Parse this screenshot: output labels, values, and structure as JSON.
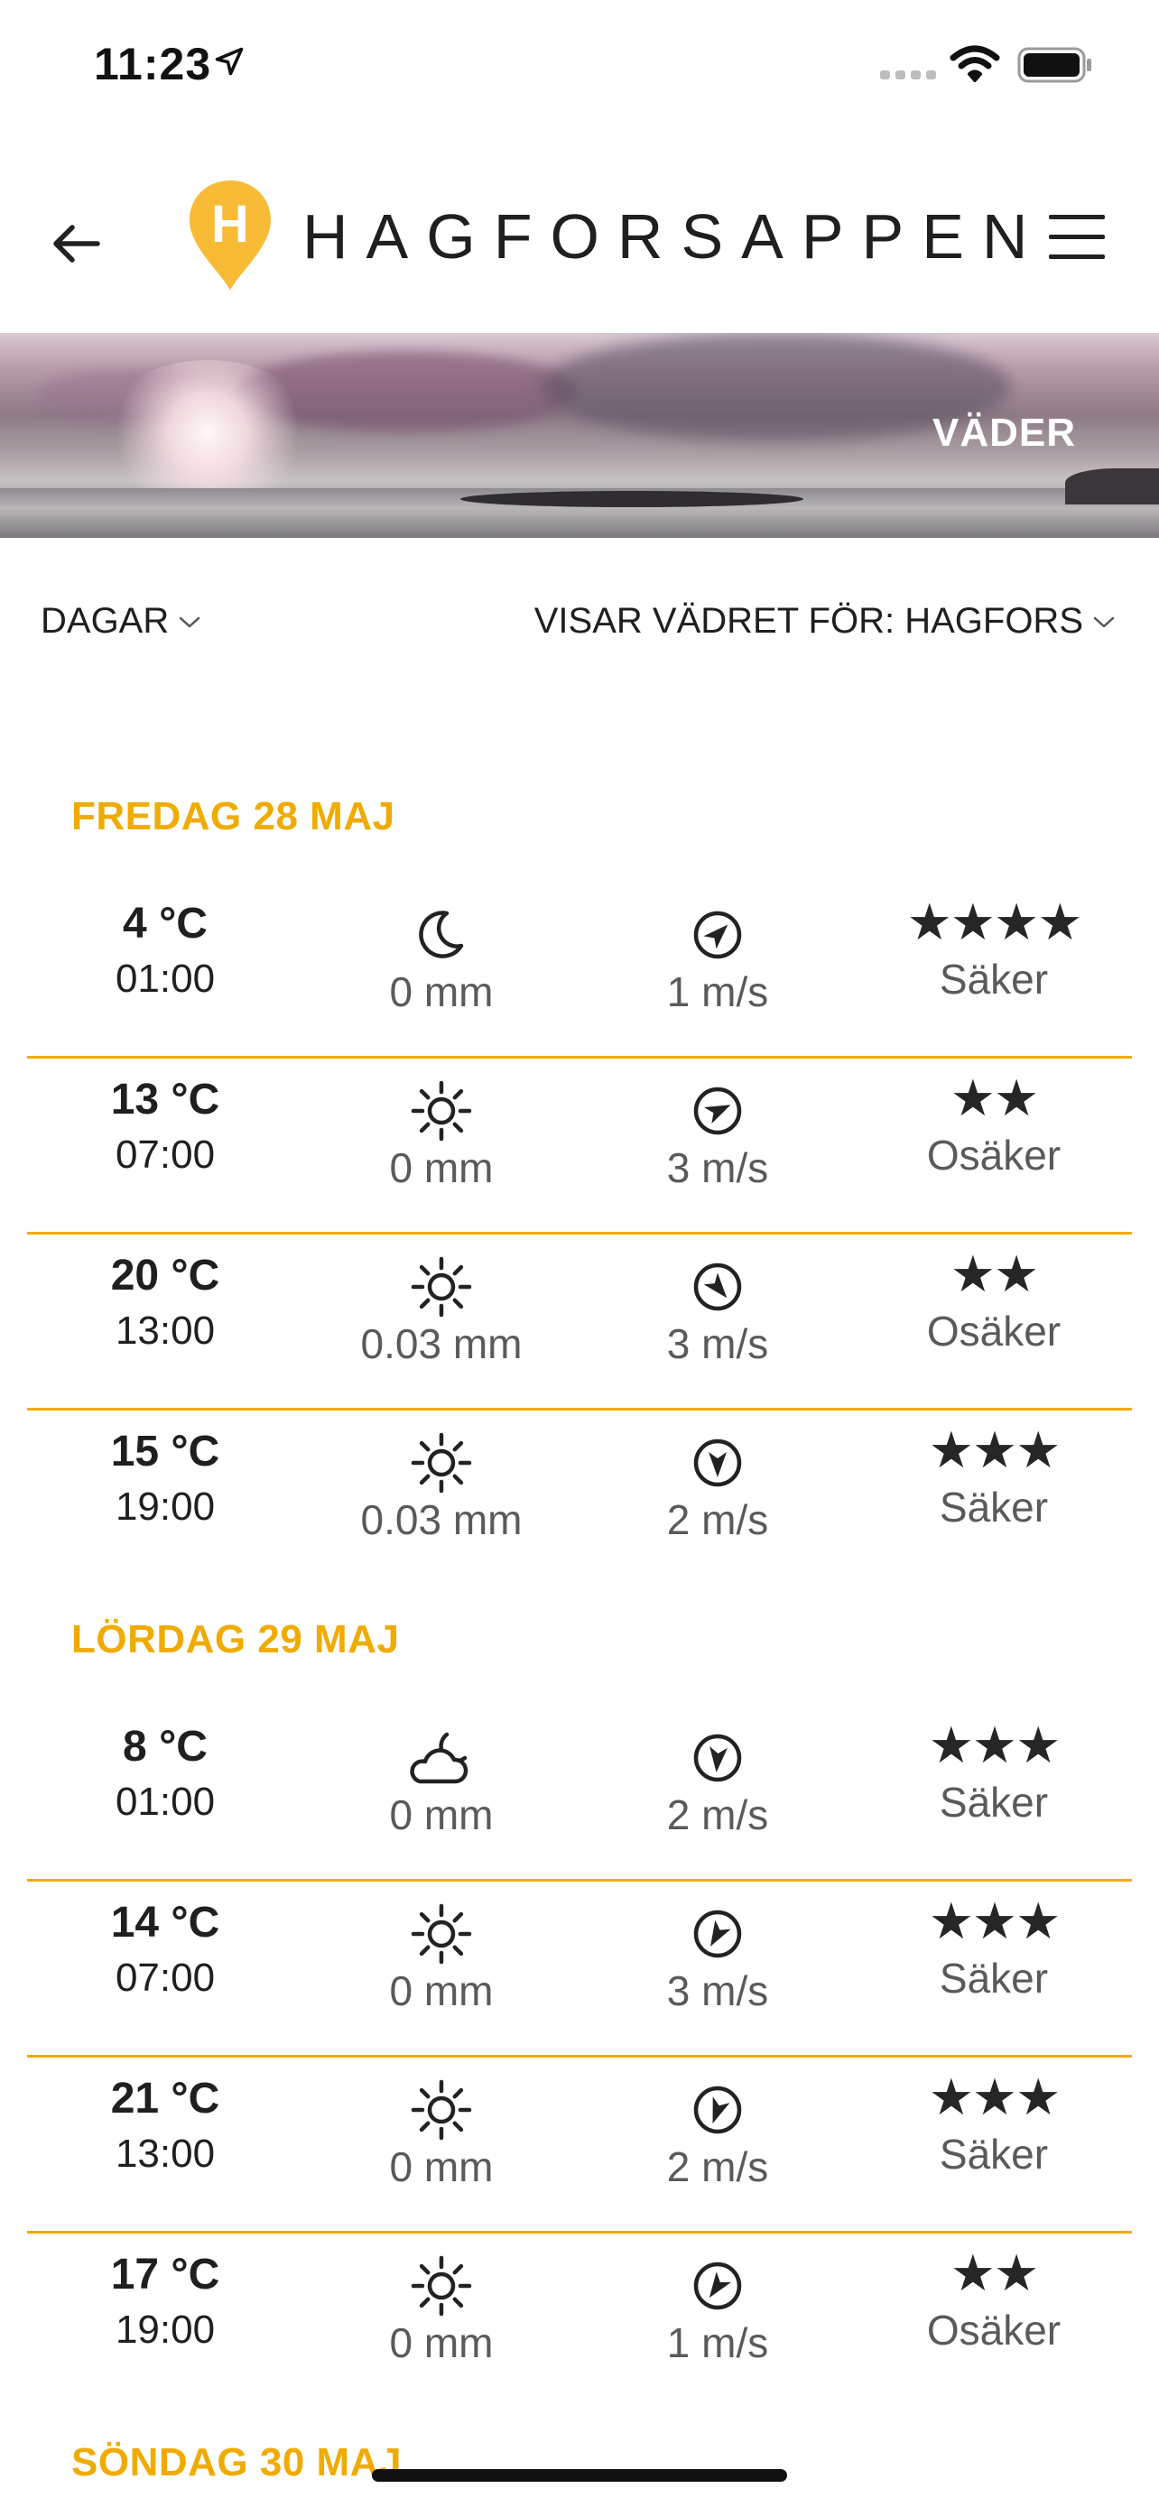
{
  "status_bar": {
    "time": "11:23"
  },
  "header": {
    "title": "HAGFORSAPPEN",
    "logo_letter": "H",
    "accent_color": "#f7bb36"
  },
  "banner": {
    "label": "VÄDER"
  },
  "filters": {
    "days_label": "DAGAR",
    "location_label": "VISAR VÄDRET FÖR: HAGFORS"
  },
  "colors": {
    "heading": "#f0ab00",
    "divider": "#f0ab00",
    "text": "#1f1f1f",
    "muted": "#5a5a5a"
  },
  "days": [
    {
      "heading": "FREDAG 28 MAJ",
      "rows": [
        {
          "temp": "4 °C",
          "time": "01:00",
          "weather_icon": "moon-icon",
          "precip": "0 mm",
          "wind_dir_deg": 45,
          "wind": "1 m/s",
          "stars": "★★★★",
          "confidence": "Säker"
        },
        {
          "temp": "13 °C",
          "time": "07:00",
          "weather_icon": "sun-icon",
          "precip": "0 mm",
          "wind_dir_deg": 65,
          "wind": "3 m/s",
          "stars": "★★",
          "confidence": "Osäker"
        },
        {
          "temp": "20 °C",
          "time": "13:00",
          "weather_icon": "sun-icon",
          "precip": "0.03 mm",
          "wind_dir_deg": 140,
          "wind": "3 m/s",
          "stars": "★★",
          "confidence": "Osäker"
        },
        {
          "temp": "15 °C",
          "time": "19:00",
          "weather_icon": "sun-icon",
          "precip": "0.03 mm",
          "wind_dir_deg": 180,
          "wind": "2 m/s",
          "stars": "★★★",
          "confidence": "Säker"
        }
      ]
    },
    {
      "heading": "LÖRDAG 29 MAJ",
      "rows": [
        {
          "temp": "8 °C",
          "time": "01:00",
          "weather_icon": "cloud-moon-icon",
          "precip": "0 mm",
          "wind_dir_deg": 185,
          "wind": "2 m/s",
          "stars": "★★★",
          "confidence": "Säker"
        },
        {
          "temp": "14 °C",
          "time": "07:00",
          "weather_icon": "sun-icon",
          "precip": "0 mm",
          "wind_dir_deg": 210,
          "wind": "3 m/s",
          "stars": "★★★",
          "confidence": "Säker"
        },
        {
          "temp": "21 °C",
          "time": "13:00",
          "weather_icon": "sun-icon",
          "precip": "0 mm",
          "wind_dir_deg": 200,
          "wind": "2 m/s",
          "stars": "★★★",
          "confidence": "Säker"
        },
        {
          "temp": "17 °C",
          "time": "19:00",
          "weather_icon": "sun-icon",
          "precip": "0 mm",
          "wind_dir_deg": 215,
          "wind": "1 m/s",
          "stars": "★★",
          "confidence": "Osäker"
        }
      ]
    },
    {
      "heading": "SÖNDAG 30 MAJ",
      "rows": []
    }
  ]
}
